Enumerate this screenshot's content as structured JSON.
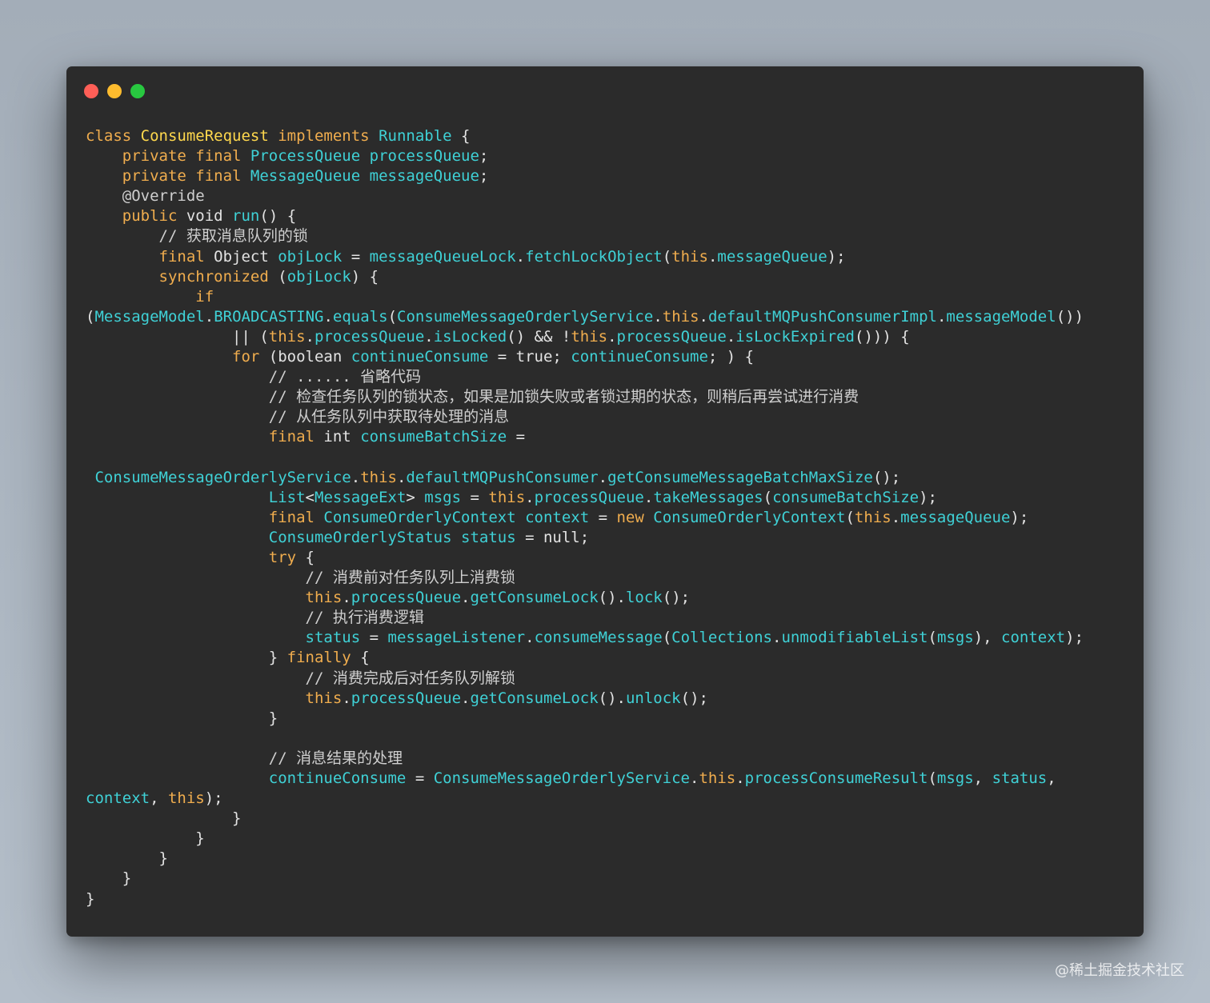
{
  "window": {
    "controls": [
      {
        "name": "close",
        "color": "#ff5f57"
      },
      {
        "name": "minimize",
        "color": "#febc2e"
      },
      {
        "name": "zoom",
        "color": "#28c840"
      }
    ]
  },
  "colors": {
    "background": "#abb5c0",
    "window": "#2b2b2b",
    "keyword": "#f0ad4e",
    "class_name": "#ffd84d",
    "identifier": "#3fd1d6",
    "comment": "#cfcfcf",
    "plain": "#e3e3e3"
  },
  "code_lines": [
    [
      [
        "kw",
        "class "
      ],
      [
        "cls",
        "ConsumeRequest"
      ],
      [
        "kw",
        " implements "
      ],
      [
        "id",
        "Runnable"
      ],
      [
        "p",
        " {"
      ]
    ],
    [
      [
        "p",
        "    "
      ],
      [
        "kw",
        "private final "
      ],
      [
        "id",
        "ProcessQueue processQueue"
      ],
      [
        "p",
        ";"
      ]
    ],
    [
      [
        "p",
        "    "
      ],
      [
        "kw",
        "private final "
      ],
      [
        "id",
        "MessageQueue messageQueue"
      ],
      [
        "p",
        ";"
      ]
    ],
    [
      [
        "ann",
        "    @Override"
      ]
    ],
    [
      [
        "p",
        "    "
      ],
      [
        "kw",
        "public "
      ],
      [
        "p",
        "void "
      ],
      [
        "id",
        "run"
      ],
      [
        "p",
        "() {"
      ]
    ],
    [
      [
        "com",
        "        // 获取消息队列的锁"
      ]
    ],
    [
      [
        "p",
        "        "
      ],
      [
        "kw",
        "final "
      ],
      [
        "p",
        "Object "
      ],
      [
        "id",
        "objLock"
      ],
      [
        "p",
        " = "
      ],
      [
        "id",
        "messageQueueLock"
      ],
      [
        "p",
        "."
      ],
      [
        "id",
        "fetchLockObject"
      ],
      [
        "p",
        "("
      ],
      [
        "kw",
        "this"
      ],
      [
        "p",
        "."
      ],
      [
        "id",
        "messageQueue"
      ],
      [
        "p",
        ");"
      ]
    ],
    [
      [
        "p",
        "        "
      ],
      [
        "kw",
        "synchronized "
      ],
      [
        "p",
        "("
      ],
      [
        "id",
        "objLock"
      ],
      [
        "p",
        ") {"
      ]
    ],
    [
      [
        "p",
        "            "
      ],
      [
        "kw",
        "if"
      ]
    ],
    [
      [
        "p",
        "("
      ],
      [
        "id",
        "MessageModel"
      ],
      [
        "p",
        "."
      ],
      [
        "id",
        "BROADCASTING"
      ],
      [
        "p",
        "."
      ],
      [
        "id",
        "equals"
      ],
      [
        "p",
        "("
      ],
      [
        "id",
        "ConsumeMessageOrderlyService"
      ],
      [
        "p",
        "."
      ],
      [
        "kw",
        "this"
      ],
      [
        "p",
        "."
      ],
      [
        "id",
        "defaultMQPushConsumerImpl"
      ],
      [
        "p",
        "."
      ],
      [
        "id",
        "messageModel"
      ],
      [
        "p",
        "())"
      ]
    ],
    [
      [
        "p",
        "                || ("
      ],
      [
        "kw",
        "this"
      ],
      [
        "p",
        "."
      ],
      [
        "id",
        "processQueue"
      ],
      [
        "p",
        "."
      ],
      [
        "id",
        "isLocked"
      ],
      [
        "p",
        "() && !"
      ],
      [
        "kw",
        "this"
      ],
      [
        "p",
        "."
      ],
      [
        "id",
        "processQueue"
      ],
      [
        "p",
        "."
      ],
      [
        "id",
        "isLockExpired"
      ],
      [
        "p",
        "())) {"
      ]
    ],
    [
      [
        "p",
        "                "
      ],
      [
        "kw",
        "for "
      ],
      [
        "p",
        "(boolean "
      ],
      [
        "id",
        "continueConsume"
      ],
      [
        "p",
        " = true; "
      ],
      [
        "id",
        "continueConsume"
      ],
      [
        "p",
        "; ) {"
      ]
    ],
    [
      [
        "com",
        "                    // ...... 省略代码"
      ]
    ],
    [
      [
        "com",
        "                    // 检查任务队列的锁状态，如果是加锁失败或者锁过期的状态，则稍后再尝试进行消费"
      ]
    ],
    [
      [
        "com",
        "                    // 从任务队列中获取待处理的消息"
      ]
    ],
    [
      [
        "p",
        "                    "
      ],
      [
        "kw",
        "final "
      ],
      [
        "p",
        "int "
      ],
      [
        "id",
        "consumeBatchSize"
      ],
      [
        "p",
        " ="
      ]
    ],
    [
      [
        "p",
        ""
      ]
    ],
    [
      [
        "p",
        " "
      ],
      [
        "id",
        "ConsumeMessageOrderlyService"
      ],
      [
        "p",
        "."
      ],
      [
        "kw",
        "this"
      ],
      [
        "p",
        "."
      ],
      [
        "id",
        "defaultMQPushConsumer"
      ],
      [
        "p",
        "."
      ],
      [
        "id",
        "getConsumeMessageBatchMaxSize"
      ],
      [
        "p",
        "();"
      ]
    ],
    [
      [
        "p",
        "                    "
      ],
      [
        "id",
        "List"
      ],
      [
        "p",
        "<"
      ],
      [
        "id",
        "MessageExt"
      ],
      [
        "p",
        "> "
      ],
      [
        "id",
        "msgs"
      ],
      [
        "p",
        " = "
      ],
      [
        "kw",
        "this"
      ],
      [
        "p",
        "."
      ],
      [
        "id",
        "processQueue"
      ],
      [
        "p",
        "."
      ],
      [
        "id",
        "takeMessages"
      ],
      [
        "p",
        "("
      ],
      [
        "id",
        "consumeBatchSize"
      ],
      [
        "p",
        ");"
      ]
    ],
    [
      [
        "p",
        "                    "
      ],
      [
        "kw",
        "final "
      ],
      [
        "id",
        "ConsumeOrderlyContext context"
      ],
      [
        "p",
        " = "
      ],
      [
        "kw",
        "new "
      ],
      [
        "id",
        "ConsumeOrderlyContext"
      ],
      [
        "p",
        "("
      ],
      [
        "kw",
        "this"
      ],
      [
        "p",
        "."
      ],
      [
        "id",
        "messageQueue"
      ],
      [
        "p",
        ");"
      ]
    ],
    [
      [
        "p",
        "                    "
      ],
      [
        "id",
        "ConsumeOrderlyStatus status"
      ],
      [
        "p",
        " = null;"
      ]
    ],
    [
      [
        "p",
        "                    "
      ],
      [
        "kw",
        "try"
      ],
      [
        "p",
        " {"
      ]
    ],
    [
      [
        "com",
        "                        // 消费前对任务队列上消费锁"
      ]
    ],
    [
      [
        "p",
        "                        "
      ],
      [
        "kw",
        "this"
      ],
      [
        "p",
        "."
      ],
      [
        "id",
        "processQueue"
      ],
      [
        "p",
        "."
      ],
      [
        "id",
        "getConsumeLock"
      ],
      [
        "p",
        "()."
      ],
      [
        "id",
        "lock"
      ],
      [
        "p",
        "();"
      ]
    ],
    [
      [
        "com",
        "                        // 执行消费逻辑"
      ]
    ],
    [
      [
        "p",
        "                        "
      ],
      [
        "id",
        "status"
      ],
      [
        "p",
        " = "
      ],
      [
        "id",
        "messageListener"
      ],
      [
        "p",
        "."
      ],
      [
        "id",
        "consumeMessage"
      ],
      [
        "p",
        "("
      ],
      [
        "id",
        "Collections"
      ],
      [
        "p",
        "."
      ],
      [
        "id",
        "unmodifiableList"
      ],
      [
        "p",
        "("
      ],
      [
        "id",
        "msgs"
      ],
      [
        "p",
        "), "
      ],
      [
        "id",
        "context"
      ],
      [
        "p",
        ");"
      ]
    ],
    [
      [
        "p",
        "                    } "
      ],
      [
        "kw",
        "finally"
      ],
      [
        "p",
        " {"
      ]
    ],
    [
      [
        "com",
        "                        // 消费完成后对任务队列解锁"
      ]
    ],
    [
      [
        "p",
        "                        "
      ],
      [
        "kw",
        "this"
      ],
      [
        "p",
        "."
      ],
      [
        "id",
        "processQueue"
      ],
      [
        "p",
        "."
      ],
      [
        "id",
        "getConsumeLock"
      ],
      [
        "p",
        "()."
      ],
      [
        "id",
        "unlock"
      ],
      [
        "p",
        "();"
      ]
    ],
    [
      [
        "p",
        "                    }"
      ]
    ],
    [
      [
        "p",
        ""
      ]
    ],
    [
      [
        "com",
        "                    // 消息结果的处理"
      ]
    ],
    [
      [
        "p",
        "                    "
      ],
      [
        "id",
        "continueConsume"
      ],
      [
        "p",
        " = "
      ],
      [
        "id",
        "ConsumeMessageOrderlyService"
      ],
      [
        "p",
        "."
      ],
      [
        "kw",
        "this"
      ],
      [
        "p",
        "."
      ],
      [
        "id",
        "processConsumeResult"
      ],
      [
        "p",
        "("
      ],
      [
        "id",
        "msgs"
      ],
      [
        "p",
        ", "
      ],
      [
        "id",
        "status"
      ],
      [
        "p",
        ","
      ]
    ],
    [
      [
        "id",
        "context"
      ],
      [
        "p",
        ", "
      ],
      [
        "kw",
        "this"
      ],
      [
        "p",
        ");"
      ]
    ],
    [
      [
        "p",
        "                }"
      ]
    ],
    [
      [
        "p",
        "            }"
      ]
    ],
    [
      [
        "p",
        "        }"
      ]
    ],
    [
      [
        "p",
        "    }"
      ]
    ],
    [
      [
        "p",
        "}"
      ]
    ]
  ],
  "watermark": "@稀土掘金技术社区"
}
